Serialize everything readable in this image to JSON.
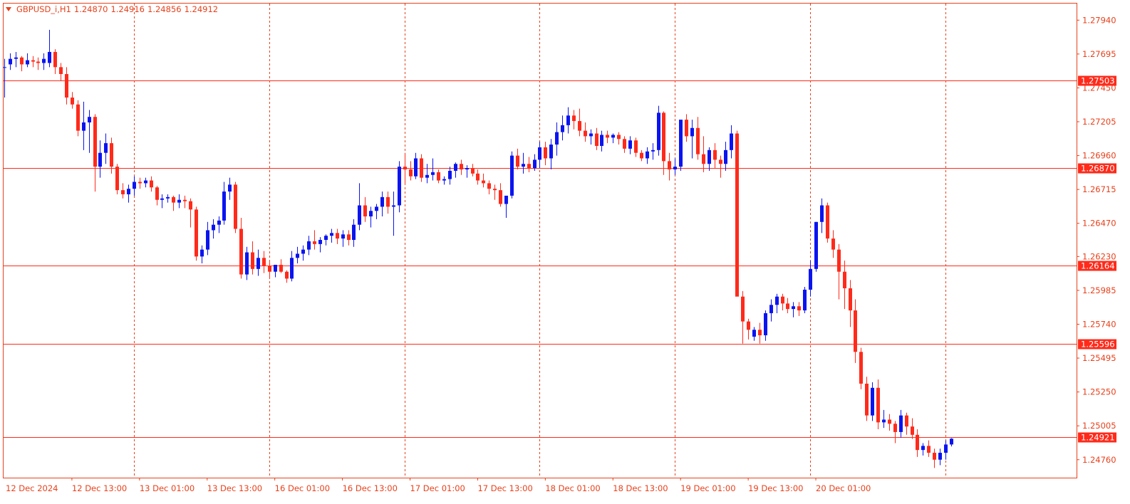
{
  "header": {
    "symbol": "GBPUSD_i,H1",
    "open": "1.24870",
    "high": "1.24916",
    "low": "1.24856",
    "close": "1.24912"
  },
  "colors": {
    "background": "#ffffff",
    "frame": "#e8411c",
    "text": "#e8411c",
    "bull_candle": "#0a14f0",
    "bear_candle": "#ff2a1a",
    "hline": "#ff2a1a",
    "vgrid": "#e8411c"
  },
  "chart_data": {
    "type": "candlestick",
    "timeframe": "H1",
    "y_range": [
      1.2463,
      1.2806
    ],
    "price_ticks": [
      "1.27940",
      "1.27695",
      "1.27450",
      "1.27205",
      "1.26960",
      "1.26715",
      "1.26470",
      "1.26230",
      "1.25985",
      "1.25740",
      "1.25495",
      "1.25250",
      "1.25005",
      "1.24760"
    ],
    "time_ticks": [
      "12 Dec 2024",
      "12 Dec 13:00",
      "13 Dec 01:00",
      "13 Dec 13:00",
      "16 Dec 01:00",
      "16 Dec 13:00",
      "17 Dec 01:00",
      "17 Dec 13:00",
      "18 Dec 01:00",
      "18 Dec 13:00",
      "19 Dec 01:00",
      "19 Dec 13:00",
      "20 Dec 01:00"
    ],
    "vertical_separators_bar_index": [
      23,
      47,
      71,
      95,
      119,
      143,
      167
    ],
    "horizontal_levels": [
      "1.27503",
      "1.26870",
      "1.26164",
      "1.25596",
      "1.24921"
    ],
    "bars": [
      [
        1.276,
        1.2766,
        1.2738,
        1.276
      ],
      [
        1.2762,
        1.277,
        1.2758,
        1.2766
      ],
      [
        1.2766,
        1.2771,
        1.276,
        1.2767
      ],
      [
        1.2767,
        1.2768,
        1.2757,
        1.2762
      ],
      [
        1.2762,
        1.277,
        1.276,
        1.2765
      ],
      [
        1.2765,
        1.2768,
        1.276,
        1.2764
      ],
      [
        1.2764,
        1.2767,
        1.2758,
        1.2763
      ],
      [
        1.2763,
        1.277,
        1.2758,
        1.2766
      ],
      [
        1.2763,
        1.2787,
        1.276,
        1.2771
      ],
      [
        1.2771,
        1.2773,
        1.2755,
        1.276
      ],
      [
        1.276,
        1.2763,
        1.275,
        1.2755
      ],
      [
        1.2755,
        1.276,
        1.2733,
        1.2738
      ],
      [
        1.2738,
        1.2742,
        1.273,
        1.2733
      ],
      [
        1.2733,
        1.2736,
        1.271,
        1.2714
      ],
      [
        1.2714,
        1.2735,
        1.27,
        1.272
      ],
      [
        1.272,
        1.2729,
        1.2698,
        1.2724
      ],
      [
        1.2724,
        1.2726,
        1.267,
        1.2688
      ],
      [
        1.2688,
        1.2707,
        1.268,
        1.2698
      ],
      [
        1.2698,
        1.2712,
        1.269,
        1.2705
      ],
      [
        1.2705,
        1.2709,
        1.2683,
        1.2688
      ],
      [
        1.2688,
        1.269,
        1.2668,
        1.2671
      ],
      [
        1.2671,
        1.2676,
        1.2665,
        1.2668
      ],
      [
        1.2668,
        1.2675,
        1.2662,
        1.2672
      ],
      [
        1.2672,
        1.2681,
        1.2667,
        1.2677
      ],
      [
        1.2677,
        1.268,
        1.2672,
        1.2676
      ],
      [
        1.2676,
        1.268,
        1.2673,
        1.2678
      ],
      [
        1.2678,
        1.2681,
        1.267,
        1.2673
      ],
      [
        1.2673,
        1.2674,
        1.266,
        1.2664
      ],
      [
        1.2664,
        1.2668,
        1.2658,
        1.2665
      ],
      [
        1.2665,
        1.2668,
        1.2662,
        1.2666
      ],
      [
        1.2666,
        1.2667,
        1.2656,
        1.2662
      ],
      [
        1.2662,
        1.2668,
        1.2658,
        1.2664
      ],
      [
        1.2664,
        1.2667,
        1.2658,
        1.2663
      ],
      [
        1.2663,
        1.2665,
        1.2644,
        1.2657
      ],
      [
        1.2657,
        1.2659,
        1.262,
        1.2623
      ],
      [
        1.2623,
        1.2631,
        1.2618,
        1.2628
      ],
      [
        1.2628,
        1.2648,
        1.2624,
        1.2642
      ],
      [
        1.2642,
        1.265,
        1.2636,
        1.2646
      ],
      [
        1.2646,
        1.2652,
        1.264,
        1.2649
      ],
      [
        1.2649,
        1.2677,
        1.2646,
        1.267
      ],
      [
        1.267,
        1.268,
        1.2664,
        1.2675
      ],
      [
        1.2675,
        1.2677,
        1.264,
        1.2643
      ],
      [
        1.2643,
        1.2651,
        1.2607,
        1.261
      ],
      [
        1.261,
        1.263,
        1.2606,
        1.2626
      ],
      [
        1.2626,
        1.2634,
        1.261,
        1.2614
      ],
      [
        1.2614,
        1.2628,
        1.2609,
        1.2622
      ],
      [
        1.2622,
        1.2627,
        1.2611,
        1.2616
      ],
      [
        1.2616,
        1.2619,
        1.2607,
        1.2612
      ],
      [
        1.2612,
        1.2615,
        1.2608,
        1.2617
      ],
      [
        1.2617,
        1.2621,
        1.2611,
        1.2612
      ],
      [
        1.2612,
        1.2613,
        1.2604,
        1.2607
      ],
      [
        1.2607,
        1.2627,
        1.2605,
        1.2622
      ],
      [
        1.2622,
        1.263,
        1.2618,
        1.2625
      ],
      [
        1.2625,
        1.2631,
        1.262,
        1.2628
      ],
      [
        1.2628,
        1.2638,
        1.2624,
        1.2634
      ],
      [
        1.2634,
        1.2642,
        1.2628,
        1.2632
      ],
      [
        1.2632,
        1.2637,
        1.2626,
        1.2635
      ],
      [
        1.2635,
        1.2639,
        1.2631,
        1.2638
      ],
      [
        1.2638,
        1.2643,
        1.2633,
        1.264
      ],
      [
        1.264,
        1.2643,
        1.2632,
        1.2636
      ],
      [
        1.2636,
        1.2642,
        1.263,
        1.2639
      ],
      [
        1.2639,
        1.2642,
        1.2631,
        1.2635
      ],
      [
        1.2635,
        1.265,
        1.263,
        1.2646
      ],
      [
        1.2646,
        1.2676,
        1.2642,
        1.266
      ],
      [
        1.266,
        1.2666,
        1.2648,
        1.2652
      ],
      [
        1.2652,
        1.2659,
        1.2644,
        1.2656
      ],
      [
        1.2656,
        1.2661,
        1.265,
        1.2659
      ],
      [
        1.2659,
        1.267,
        1.2652,
        1.2666
      ],
      [
        1.2666,
        1.267,
        1.2654,
        1.2659
      ],
      [
        1.2659,
        1.267,
        1.2638,
        1.266
      ],
      [
        1.266,
        1.2692,
        1.2655,
        1.2688
      ],
      [
        1.2688,
        1.2698,
        1.2676,
        1.2686
      ],
      [
        1.2686,
        1.2692,
        1.2678,
        1.2681
      ],
      [
        1.2681,
        1.2698,
        1.2679,
        1.2694
      ],
      [
        1.2694,
        1.2697,
        1.2677,
        1.268
      ],
      [
        1.268,
        1.269,
        1.2676,
        1.2682
      ],
      [
        1.2682,
        1.2694,
        1.2678,
        1.2684
      ],
      [
        1.2684,
        1.2686,
        1.2676,
        1.2678
      ],
      [
        1.2678,
        1.2681,
        1.2675,
        1.2679
      ],
      [
        1.2679,
        1.2688,
        1.2675,
        1.2685
      ],
      [
        1.2685,
        1.2691,
        1.268,
        1.269
      ],
      [
        1.269,
        1.2693,
        1.2682,
        1.2686
      ],
      [
        1.2686,
        1.2689,
        1.268,
        1.2687
      ],
      [
        1.2687,
        1.269,
        1.2681,
        1.2683
      ],
      [
        1.2683,
        1.2686,
        1.2675,
        1.2678
      ],
      [
        1.2678,
        1.2683,
        1.2673,
        1.2676
      ],
      [
        1.2676,
        1.2678,
        1.2668,
        1.2672
      ],
      [
        1.2672,
        1.2675,
        1.2664,
        1.2671
      ],
      [
        1.2671,
        1.2676,
        1.2659,
        1.2661
      ],
      [
        1.2661,
        1.2664,
        1.2651,
        1.2667
      ],
      [
        1.2667,
        1.2699,
        1.2665,
        1.2696
      ],
      [
        1.2696,
        1.2701,
        1.2686,
        1.2688
      ],
      [
        1.2688,
        1.2698,
        1.2683,
        1.269
      ],
      [
        1.269,
        1.2695,
        1.2684,
        1.2687
      ],
      [
        1.2687,
        1.2697,
        1.2685,
        1.2693
      ],
      [
        1.2693,
        1.2706,
        1.2687,
        1.2702
      ],
      [
        1.2702,
        1.2706,
        1.2689,
        1.2694
      ],
      [
        1.2694,
        1.2708,
        1.2686,
        1.2704
      ],
      [
        1.2704,
        1.272,
        1.2696,
        1.2713
      ],
      [
        1.2713,
        1.2725,
        1.2707,
        1.2718
      ],
      [
        1.2718,
        1.2731,
        1.2712,
        1.2725
      ],
      [
        1.2725,
        1.2729,
        1.2715,
        1.2721
      ],
      [
        1.2721,
        1.273,
        1.271,
        1.2714
      ],
      [
        1.2714,
        1.272,
        1.2706,
        1.271
      ],
      [
        1.271,
        1.2715,
        1.2704,
        1.2712
      ],
      [
        1.2712,
        1.2716,
        1.27,
        1.2703
      ],
      [
        1.2703,
        1.2714,
        1.2699,
        1.2711
      ],
      [
        1.2711,
        1.2714,
        1.2705,
        1.2709
      ],
      [
        1.2709,
        1.2712,
        1.2705,
        1.2711
      ],
      [
        1.2711,
        1.2713,
        1.2704,
        1.2708
      ],
      [
        1.2708,
        1.271,
        1.2698,
        1.2701
      ],
      [
        1.2701,
        1.271,
        1.2697,
        1.2707
      ],
      [
        1.2707,
        1.2709,
        1.2695,
        1.2698
      ],
      [
        1.2698,
        1.27,
        1.2692,
        1.2694
      ],
      [
        1.2694,
        1.2702,
        1.269,
        1.2699
      ],
      [
        1.2699,
        1.2705,
        1.2693,
        1.27
      ],
      [
        1.27,
        1.2732,
        1.2696,
        1.2727
      ],
      [
        1.2727,
        1.2728,
        1.2682,
        1.2692
      ],
      [
        1.2692,
        1.2698,
        1.2678,
        1.2686
      ],
      [
        1.2686,
        1.2694,
        1.2682,
        1.2688
      ],
      [
        1.2688,
        1.271,
        1.2685,
        1.2722
      ],
      [
        1.2722,
        1.2726,
        1.2706,
        1.271
      ],
      [
        1.271,
        1.2722,
        1.2694,
        1.2716
      ],
      [
        1.2716,
        1.2724,
        1.2693,
        1.2697
      ],
      [
        1.2697,
        1.271,
        1.2684,
        1.269
      ],
      [
        1.269,
        1.2702,
        1.2685,
        1.27
      ],
      [
        1.27,
        1.2705,
        1.2687,
        1.2693
      ],
      [
        1.2693,
        1.2696,
        1.268,
        1.269
      ],
      [
        1.269,
        1.2706,
        1.2685,
        1.27
      ],
      [
        1.27,
        1.2718,
        1.2694,
        1.2712
      ],
      [
        1.2712,
        1.2714,
        1.2596,
        1.2594
      ],
      [
        1.2594,
        1.2598,
        1.256,
        1.2576
      ],
      [
        1.2576,
        1.2578,
        1.2563,
        1.257
      ],
      [
        1.2565,
        1.2572,
        1.2562,
        1.257
      ],
      [
        1.257,
        1.2575,
        1.256,
        1.2566
      ],
      [
        1.2566,
        1.2584,
        1.2562,
        1.2582
      ],
      [
        1.2582,
        1.2592,
        1.2576,
        1.2588
      ],
      [
        1.2588,
        1.2596,
        1.2582,
        1.2594
      ],
      [
        1.2594,
        1.2596,
        1.2584,
        1.2589
      ],
      [
        1.2589,
        1.2593,
        1.2582,
        1.2585
      ],
      [
        1.2585,
        1.259,
        1.2579,
        1.2587
      ],
      [
        1.2587,
        1.259,
        1.258,
        1.2584
      ],
      [
        1.2584,
        1.2601,
        1.2582,
        1.2599
      ],
      [
        1.2599,
        1.262,
        1.2594,
        1.2614
      ],
      [
        1.2614,
        1.2648,
        1.2612,
        1.2648
      ],
      [
        1.2648,
        1.2665,
        1.264,
        1.266
      ],
      [
        1.266,
        1.2662,
        1.2633,
        1.2636
      ],
      [
        1.2636,
        1.2642,
        1.2622,
        1.2628
      ],
      [
        1.2628,
        1.2632,
        1.2592,
        1.2612
      ],
      [
        1.2612,
        1.262,
        1.2585,
        1.26
      ],
      [
        1.26,
        1.2606,
        1.2572,
        1.2584
      ],
      [
        1.2584,
        1.2592,
        1.2546,
        1.2554
      ],
      [
        1.2554,
        1.2557,
        1.2527,
        1.2531
      ],
      [
        1.2531,
        1.2536,
        1.2504,
        1.2508
      ],
      [
        1.2508,
        1.2532,
        1.2504,
        1.2528
      ],
      [
        1.2528,
        1.2534,
        1.2498,
        1.2503
      ],
      [
        1.2503,
        1.2512,
        1.2499,
        1.2505
      ],
      [
        1.2505,
        1.2509,
        1.2497,
        1.2502
      ],
      [
        1.2502,
        1.2504,
        1.2488,
        1.2496
      ],
      [
        1.2496,
        1.2512,
        1.2492,
        1.2508
      ],
      [
        1.2508,
        1.251,
        1.2494,
        1.25
      ],
      [
        1.25,
        1.2506,
        1.2491,
        1.2494
      ],
      [
        1.2494,
        1.2498,
        1.2478,
        1.2483
      ],
      [
        1.2483,
        1.2488,
        1.2479,
        1.2486
      ],
      [
        1.2486,
        1.249,
        1.2478,
        1.2481
      ],
      [
        1.2481,
        1.2484,
        1.247,
        1.2476
      ],
      [
        1.2476,
        1.2484,
        1.2472,
        1.2481
      ],
      [
        1.2481,
        1.249,
        1.2476,
        1.2487
      ],
      [
        1.2487,
        1.24916,
        1.24856,
        1.24912
      ]
    ]
  }
}
